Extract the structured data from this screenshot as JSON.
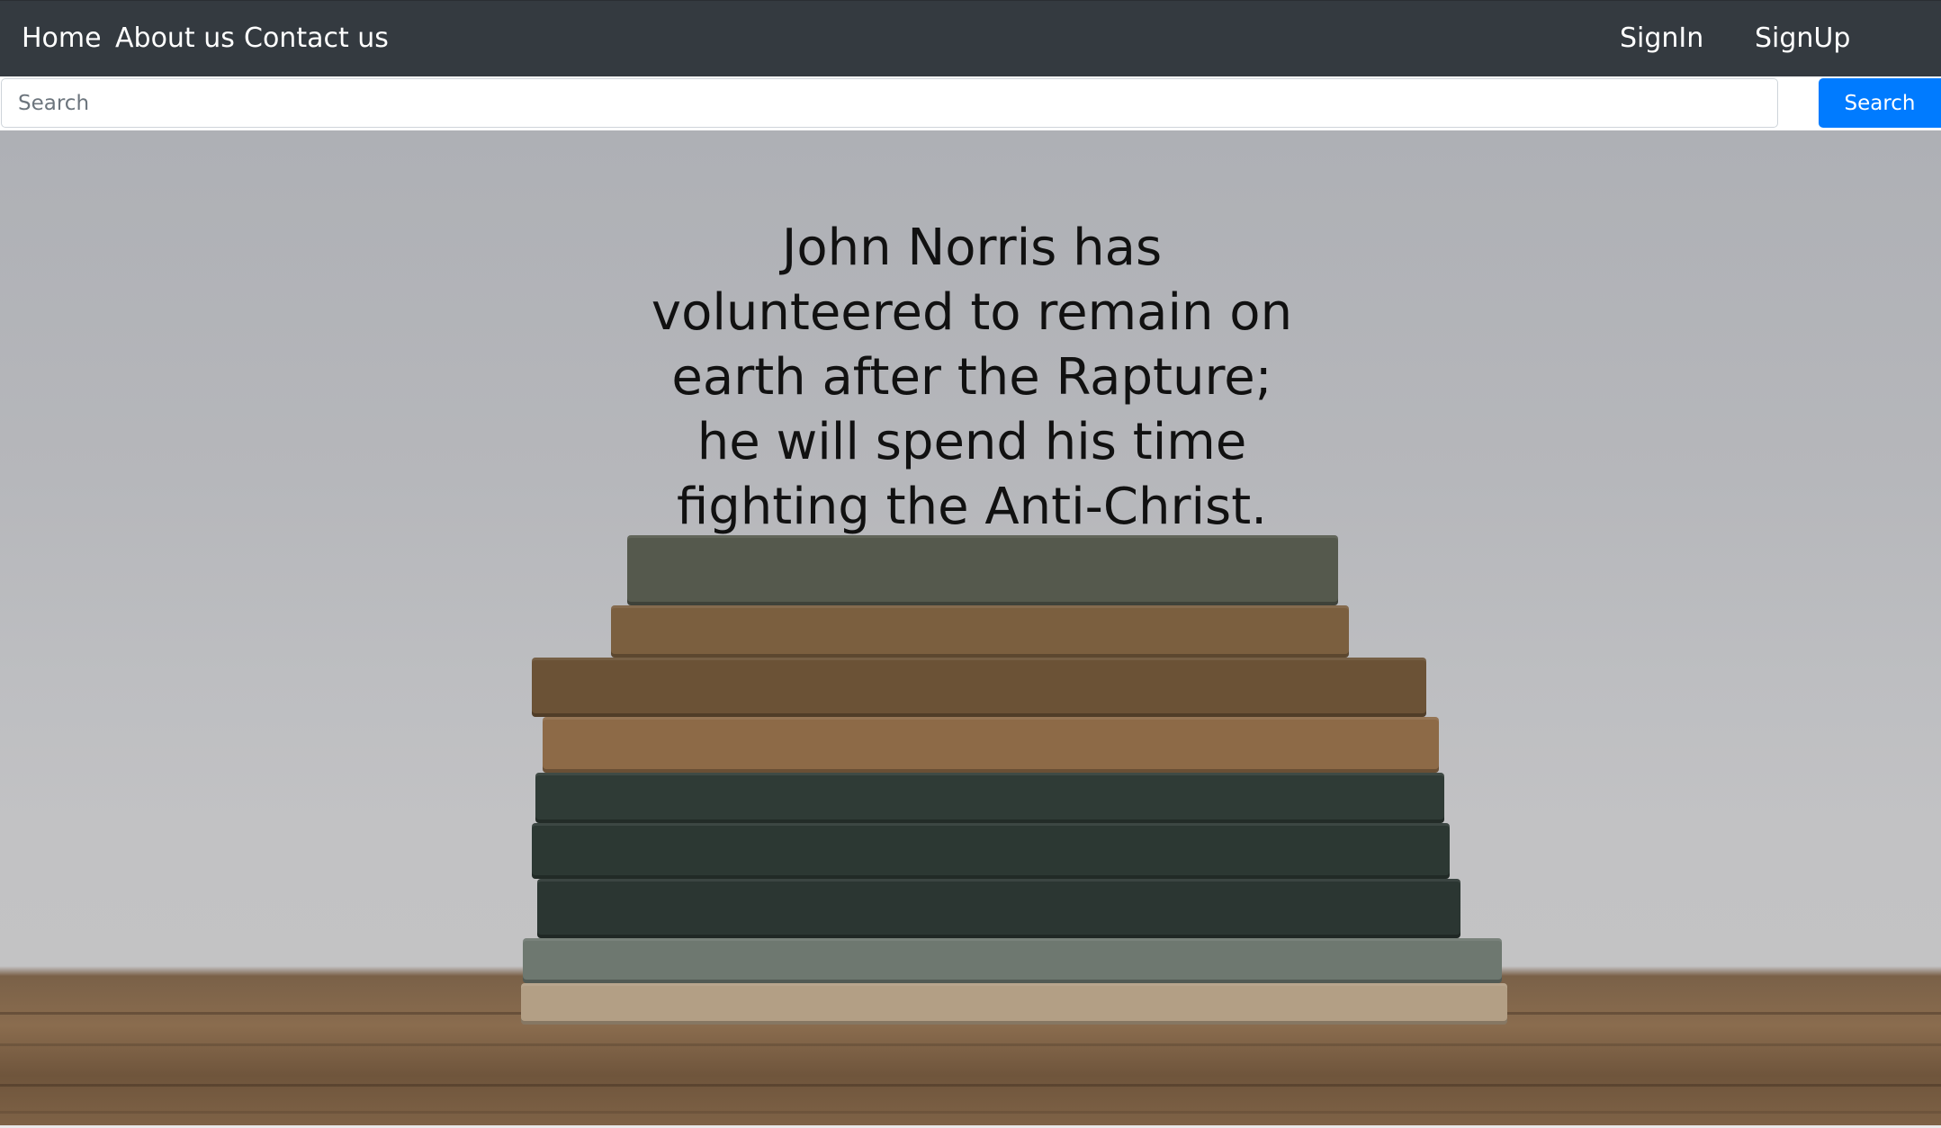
{
  "navbar": {
    "links": [
      "Home",
      "About us",
      "Contact us"
    ],
    "signin_label": "SignIn",
    "signup_label": "SignUp",
    "background_color": "#343a40"
  },
  "search": {
    "placeholder": "Search",
    "value": "",
    "button_label": "Search",
    "button_color": "#007bff"
  },
  "hero": {
    "quote": "John Norris has volunteered to remain on earth after the Rapture; he will spend his time fighting the Anti-Christ.",
    "background_image": "stack of old books on wooden table"
  }
}
